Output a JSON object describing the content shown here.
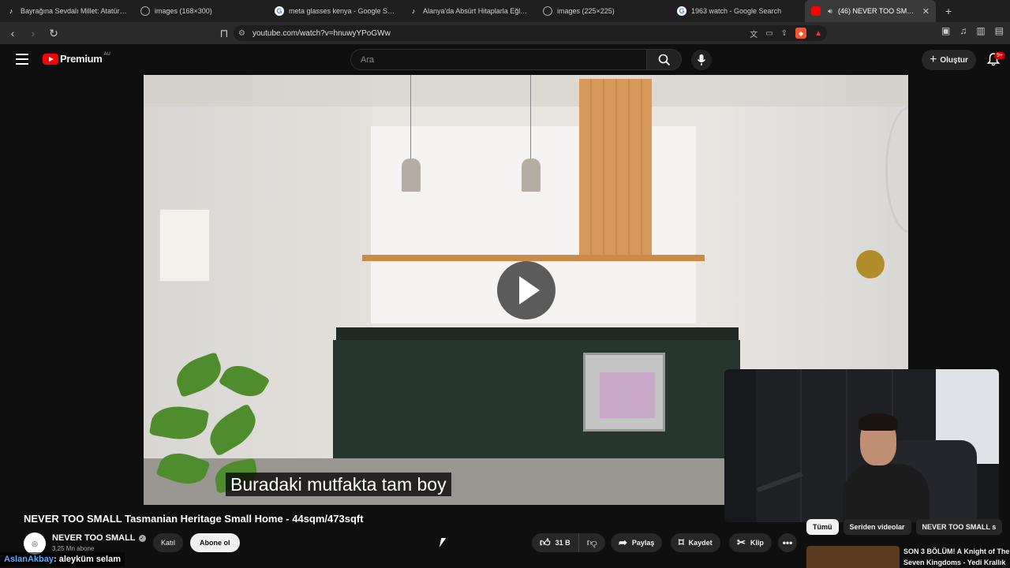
{
  "browser": {
    "tabs": [
      {
        "label": "Bayrağına Sevdalı Millet: Atatürk ve",
        "favicon": "tiktok-icon"
      },
      {
        "label": "images (168×300)",
        "favicon": "globe-icon"
      },
      {
        "label": "meta glasses kenya - Google Search",
        "favicon": "google-icon"
      },
      {
        "label": "Alanya'da Absürt Hitaplarla Eğlenceli",
        "favicon": "tiktok-icon"
      },
      {
        "label": "images (225×225)",
        "favicon": "globe-icon"
      },
      {
        "label": "1963 watch - Google Search",
        "favicon": "google-icon"
      },
      {
        "label": "(46) NEVER TOO SMALL Tasm",
        "favicon": "youtube-icon",
        "active": true
      }
    ],
    "url": "youtube.com/watch?v=hnuwyYPoGWw"
  },
  "youtube": {
    "logo_text": "Premium",
    "region": "AU",
    "search_placeholder": "Ara",
    "create_label": "Oluştur",
    "notifications_badge": "9+"
  },
  "video": {
    "subtitle": "Buradaki mutfakta tam boy",
    "title": "NEVER TOO SMALL Tasmanian Heritage Small Home - 44sqm/473sqft",
    "channel_name": "NEVER TOO SMALL",
    "subscribers": "3,25 Mn abone",
    "join_label": "Katıl",
    "subscribe_label": "Abone ol",
    "likes": "31 B",
    "share_label": "Paylaş",
    "save_label": "Kaydet",
    "clip_label": "Klip"
  },
  "sidebar": {
    "chips": [
      "Tümü",
      "Seriden videolar",
      "NEVER TOO SMALL s"
    ],
    "rec_title": "SON 3 BÖLÜM! A Knight of The Seven Kingdoms - Yedi Krallık"
  },
  "chat": {
    "user": "AslanAkbay",
    "message": ": aleyküm selam"
  },
  "colors": {
    "accent_red": "#ff0000",
    "chat_user": "#59a8ff",
    "background": "#0f0f0f"
  }
}
